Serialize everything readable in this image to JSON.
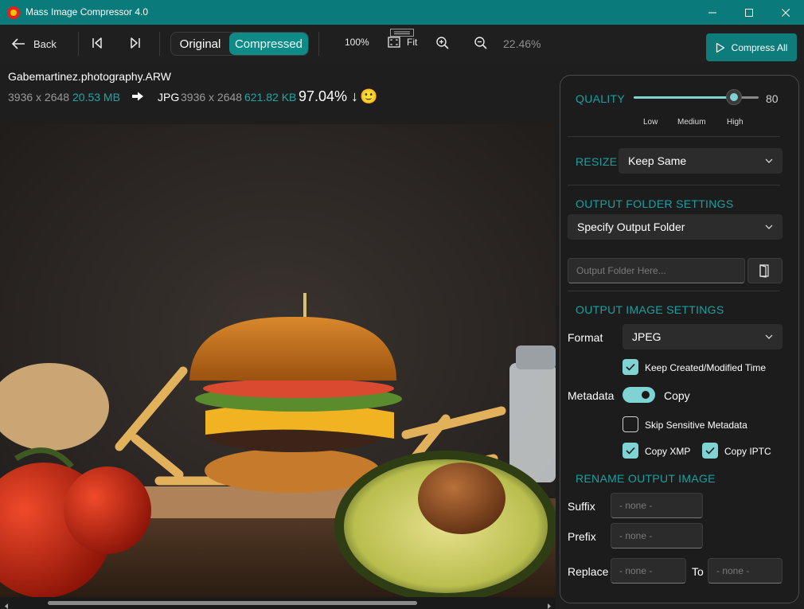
{
  "window": {
    "title": "Mass Image Compressor 4.0"
  },
  "toolbar": {
    "back_label": "Back",
    "view_tabs": {
      "original": "Original",
      "compressed": "Compressed"
    },
    "zoom_100": "100%",
    "fit_label": "Fit",
    "zoom_level": "22.46%",
    "compress_all_label": "Compress All"
  },
  "file": {
    "name": "Gabemartinez.photography.ARW",
    "original_dimensions": "3936 x 2648",
    "original_size": "20.53 MB",
    "output_format": "JPG",
    "output_dimensions": "3936 x 2648",
    "output_size": "621.82 KB",
    "reduction": "97.04% ↓",
    "emoji": "🙂"
  },
  "panel": {
    "quality": {
      "title": "QUALITY",
      "value": "80",
      "slider_fraction": 0.8,
      "ticks": [
        "Low",
        "Medium",
        "High"
      ]
    },
    "resize": {
      "title": "RESIZE",
      "selected": "Keep Same"
    },
    "output_folder": {
      "title": "OUTPUT FOLDER SETTINGS",
      "selected": "Specify Output Folder",
      "path_placeholder": "Output Folder Here..."
    },
    "output_image": {
      "title": "OUTPUT IMAGE SETTINGS",
      "format_label": "Format",
      "format_selected": "JPEG",
      "keep_time_label": "Keep Created/Modified Time",
      "keep_time_checked": true,
      "metadata_label": "Metadata",
      "metadata_toggle_label": "Copy",
      "metadata_toggle_on": true,
      "skip_sensitive_label": "Skip Sensitive Metadata",
      "skip_sensitive_checked": false,
      "copy_xmp_label": "Copy XMP",
      "copy_xmp_checked": true,
      "copy_iptc_label": "Copy IPTC",
      "copy_iptc_checked": true
    },
    "rename": {
      "title": "RENAME OUTPUT IMAGE",
      "suffix_label": "Suffix",
      "suffix_placeholder": "- none -",
      "prefix_label": "Prefix",
      "prefix_placeholder": "- none -",
      "replace_label": "Replace",
      "replace_placeholder": "- none -",
      "to_label": "To",
      "to_placeholder": "- none -"
    }
  },
  "colors": {
    "accent": "#0b7a7a",
    "accent_light": "#7fd3d3",
    "teal_text": "#1aa0a0"
  }
}
